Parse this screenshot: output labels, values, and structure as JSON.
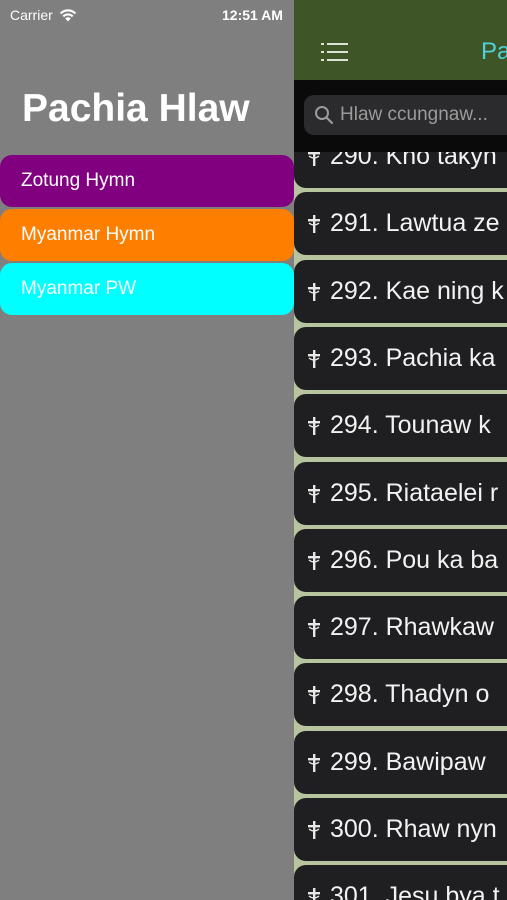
{
  "status_bar": {
    "carrier": "Carrier",
    "time": "12:51 AM"
  },
  "side_menu": {
    "title": "Pachia Hlaw",
    "items": [
      {
        "label": "Zotung Hymn",
        "color": "#800080"
      },
      {
        "label": "Myanmar Hymn",
        "color": "#fe7f00"
      },
      {
        "label": "Myanmar PW",
        "color": "#00ffff"
      }
    ]
  },
  "main": {
    "nav_title": "Pa",
    "search": {
      "placeholder": "Hlaw ccungnaw..."
    },
    "hymns": [
      "290. Kho takyn",
      "291. Lawtua ze",
      "292. Kae ning k",
      "293. Pachia ka",
      "294. Tounaw k",
      "295. Riataelei r",
      "296. Pou ka ba",
      "297. Rhawkaw",
      "298. Thadyn o",
      "299. Bawipaw",
      "300. Rhaw nyn",
      "301. Jesu bya t"
    ]
  },
  "colors": {
    "side_background": "#7f7f7f",
    "navbar": "#3e5527",
    "nav_title": "#4fd1d9",
    "row_background": "#1f1f21"
  },
  "icons": [
    "wifi-icon",
    "battery-icon",
    "hamburger-menu-icon",
    "search-icon",
    "cross-icon"
  ]
}
